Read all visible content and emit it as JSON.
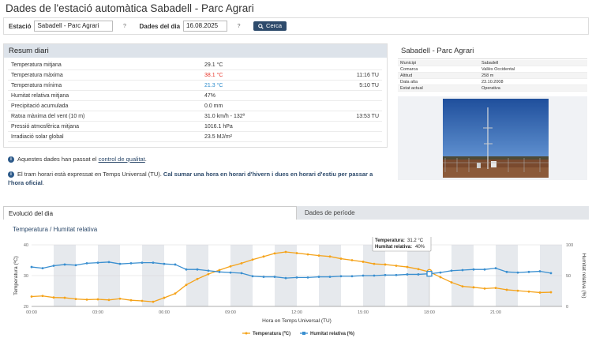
{
  "page": {
    "title": "Dades de l'estació automàtica Sabadell - Parc Agrari"
  },
  "search": {
    "station_label": "Estació",
    "station_value": "Sabadell - Parc Agrari",
    "date_label": "Dades del dia",
    "date_value": "16.08.2025",
    "help_glyph": "?",
    "button_label": "Cerca"
  },
  "summary": {
    "title": "Resum diari",
    "rows": [
      {
        "label": "Temperatura mitjana",
        "value": "29.1 °C",
        "time": "",
        "color": "#333333"
      },
      {
        "label": "Temperatura màxima",
        "value": "38.1 °C",
        "time": "11:16 TU",
        "color": "#e8362b"
      },
      {
        "label": "Temperatura mínima",
        "value": "21.3 °C",
        "time": "5:10 TU",
        "color": "#2a8acb"
      },
      {
        "label": "Humitat relativa mitjana",
        "value": "47%",
        "time": "",
        "color": "#333333"
      },
      {
        "label": "Precipitació acumulada",
        "value": "0.0 mm",
        "time": "",
        "color": "#333333"
      },
      {
        "label": "Ratxa màxima del vent (10 m)",
        "value": "31.0 km/h - 132º",
        "time": "13:53 TU",
        "color": "#333333"
      },
      {
        "label": "Pressió atmosfèrica mitjana",
        "value": "1016.1 hPa",
        "time": "",
        "color": "#333333"
      },
      {
        "label": "Irradiació solar global",
        "value": "23.5 MJ/m²",
        "time": "",
        "color": "#333333"
      }
    ]
  },
  "notes": {
    "quality_prefix": "Aquestes dades han passat el ",
    "quality_link": "control de qualitat",
    "quality_suffix": ".",
    "tz_text": "El tram horari està expressat en Temps Universal (TU). ",
    "tz_bold": "Cal sumar una hora en horari d'hivern i dues en horari d'estiu per passar a l'hora oficial",
    "tz_end": "."
  },
  "station": {
    "title": "Sabadell - Parc Agrari",
    "meta": [
      {
        "key": "Municipi",
        "value": "Sabadell"
      },
      {
        "key": "Comarca",
        "value": "Vallès Occidental"
      },
      {
        "key": "Altitud",
        "value": "258 m"
      },
      {
        "key": "Data alta",
        "value": "23.10.2008"
      },
      {
        "key": "Estat actual",
        "value": "Operativa"
      }
    ]
  },
  "tabs": {
    "active": "Evolució del dia",
    "inactive": "Dades de període"
  },
  "chart": {
    "title": "Temperatura / Humitat relativa"
  },
  "chart_data": {
    "type": "line",
    "xlabel": "Hora en Temps Universal (TU)",
    "ylabel_left": "Temperatura (ºC)",
    "ylabel_right": "Humitat relativa (%)",
    "x_ticks": [
      "00:00",
      "03:00",
      "06:00",
      "09:00",
      "12:00",
      "15:00",
      "18:00",
      "21:00"
    ],
    "y_left_ticks": [
      20,
      30,
      40
    ],
    "y_right_ticks": [
      0,
      50,
      100
    ],
    "ylim_left": [
      20,
      40
    ],
    "ylim_right": [
      0,
      100
    ],
    "x_hours": [
      0,
      0.5,
      1,
      1.5,
      2,
      2.5,
      3,
      3.5,
      4,
      4.5,
      5,
      5.5,
      6,
      6.5,
      7,
      7.5,
      8,
      8.5,
      9,
      9.5,
      10,
      10.5,
      11,
      11.5,
      12,
      12.5,
      13,
      13.5,
      14,
      14.5,
      15,
      15.5,
      16,
      16.5,
      17,
      17.5,
      18,
      18.5,
      19,
      19.5,
      20,
      20.5,
      21,
      21.5,
      22,
      22.5,
      23,
      23.5
    ],
    "series": [
      {
        "name": "Temperatura (ºC)",
        "color": "#f5a31a",
        "values": [
          23.2,
          23.4,
          22.9,
          22.8,
          22.4,
          22.2,
          22.3,
          22.1,
          22.5,
          22.0,
          21.8,
          21.5,
          22.8,
          24.2,
          27.0,
          28.9,
          30.5,
          31.8,
          33.0,
          34.0,
          35.2,
          36.2,
          37.2,
          37.7,
          37.3,
          36.9,
          36.5,
          36.2,
          35.5,
          35.0,
          34.5,
          33.8,
          33.6,
          33.2,
          32.8,
          32.1,
          31.2,
          29.5,
          27.8,
          26.5,
          26.2,
          25.8,
          26.0,
          25.4,
          25.1,
          24.8,
          24.5,
          24.6
        ]
      },
      {
        "name": "Humitat relativa (%)",
        "color": "#3a8fd0",
        "values": [
          64,
          62,
          66,
          68,
          67,
          70,
          71,
          72,
          69,
          70,
          71,
          71,
          69,
          68,
          60,
          60,
          58,
          56,
          55,
          54,
          49,
          48,
          48,
          46,
          47,
          47,
          48,
          48,
          49,
          49,
          50,
          50,
          51,
          51,
          52,
          52,
          53,
          55,
          58,
          59,
          60,
          60,
          62,
          56,
          55,
          56,
          57,
          54
        ]
      }
    ],
    "tooltip": {
      "temp_label": "Temperatura:",
      "temp_value": "31.2 °C",
      "hum_label": "Humitat relativa:",
      "hum_value": "40%"
    }
  }
}
